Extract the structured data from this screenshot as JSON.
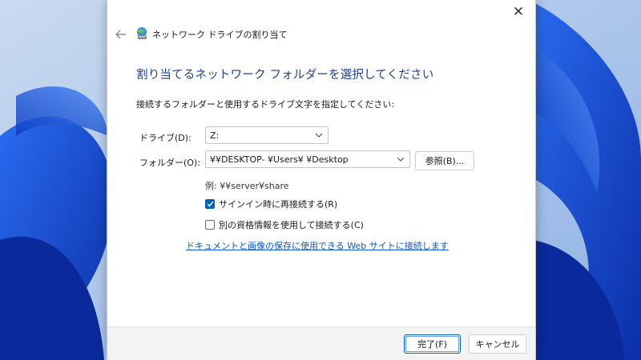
{
  "dialog": {
    "title": "ネットワーク ドライブの割り当て",
    "heading": "割り当てるネットワーク フォルダーを選択してください",
    "instruction": "接続するフォルダーと使用するドライブ文字を指定してください:",
    "drive": {
      "label": "ドライブ(D):",
      "value": "Z:"
    },
    "folder": {
      "label": "フォルダー(O):",
      "value": "¥¥DESKTOP-        ¥Users¥        ¥Desktop"
    },
    "browse_label": "参照(B)...",
    "example": "例: ¥¥server¥share",
    "reconnect": {
      "label": "サインイン時に再接続する(R)",
      "checked": true
    },
    "other_credentials": {
      "label": "別の資格情報を使用して接続する(C)",
      "checked": false
    },
    "web_link": "ドキュメントと画像の保存に使用できる Web サイトに接続します",
    "finish_label": "完了(F)",
    "cancel_label": "キャンセル"
  },
  "icons": {
    "close": "close-icon",
    "back": "back-arrow-icon",
    "network_drive": "network-drive-icon",
    "dropdown": "chevron-down-icon",
    "check": "checkmark-icon"
  },
  "colors": {
    "heading": "#1c3f94",
    "link": "#0a58ca",
    "accent": "#005fb8",
    "wallpaper": "#1a4fd6"
  }
}
